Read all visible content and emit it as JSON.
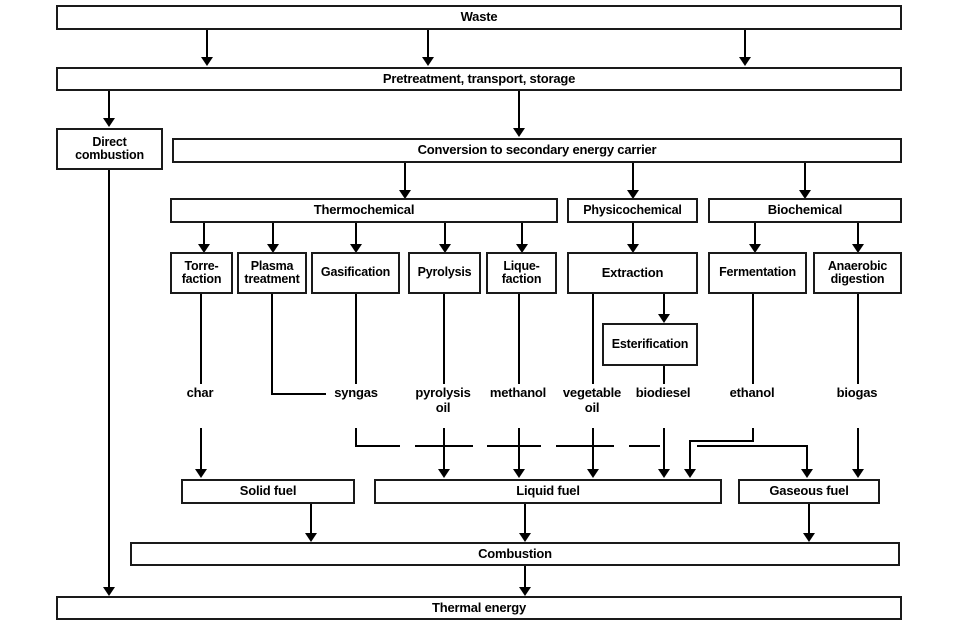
{
  "diagram": {
    "title": "Waste-to-energy conversion pathways flowchart",
    "stroke_color": "#1a1a1a",
    "background_color": "#ffffff"
  },
  "nodes": {
    "waste": "Waste",
    "pretreatment": "Pretreatment, transport, storage",
    "direct_combustion": "Direct\ncombustion",
    "conversion": "Conversion to secondary energy carrier",
    "thermochemical": "Thermochemical",
    "physicochemical": "Physicochemical",
    "biochemical": "Biochemical",
    "torrefaction": "Torre-\nfaction",
    "plasma_treatment": "Plasma\ntreatment",
    "gasification": "Gasification",
    "pyrolysis": "Pyrolysis",
    "liquefaction": "Lique-\nfaction",
    "extraction": "Extraction",
    "fermentation": "Fermentation",
    "anaerobic_digestion": "Anaerobic\ndigestion",
    "esterification": "Esterification",
    "solid_fuel": "Solid fuel",
    "liquid_fuel": "Liquid fuel",
    "gaseous_fuel": "Gaseous fuel",
    "combustion": "Combustion",
    "thermal_energy": "Thermal energy"
  },
  "products": {
    "char": "char",
    "syngas": "syngas",
    "pyrolysis_oil": "pyrolysis\noil",
    "methanol": "methanol",
    "vegetable_oil": "vegetable\noil",
    "biodiesel": "biodiesel",
    "ethanol": "ethanol",
    "biogas": "biogas"
  }
}
